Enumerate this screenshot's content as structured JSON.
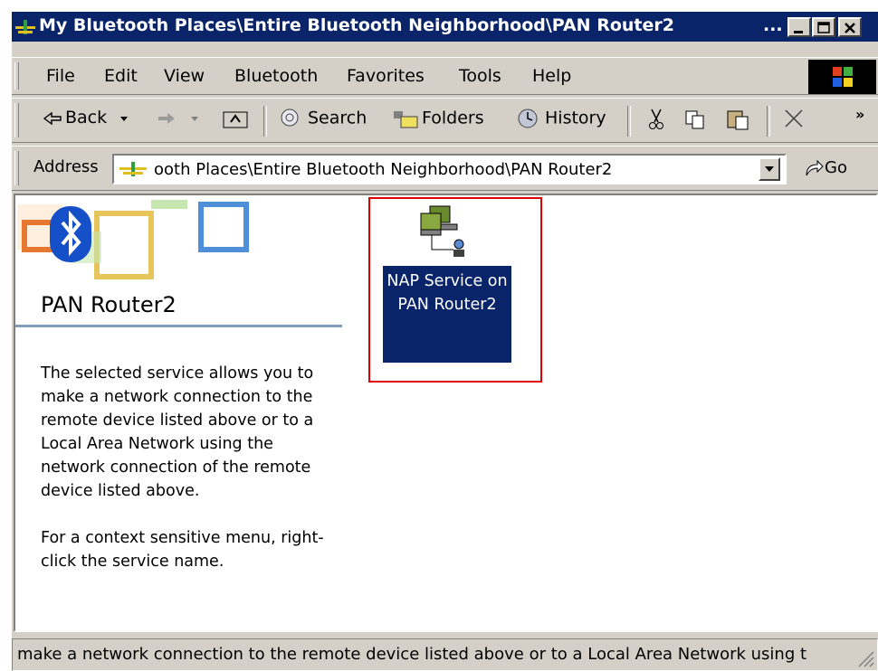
{
  "window": {
    "title": "My Bluetooth Places\\Entire Bluetooth Neighborhood\\PAN Router2",
    "title_ellipsis": "...",
    "title_color": "#0a246a"
  },
  "menu": {
    "items": [
      "File",
      "Edit",
      "View",
      "Bluetooth",
      "Favorites",
      "Tools",
      "Help"
    ]
  },
  "toolbar": {
    "back": "Back",
    "search": "Search",
    "folders": "Folders",
    "history": "History",
    "more": "»"
  },
  "address": {
    "label": "Address",
    "value": "ooth Places\\Entire Bluetooth Neighborhood\\PAN Router2",
    "go": "Go"
  },
  "left_pane": {
    "title": "PAN Router2",
    "description": "The selected service allows you to make a network connection to the remote device listed above or to a Local Area Network using the network connection of the remote device listed above.",
    "hint": "For a context sensitive menu, right-click the service name."
  },
  "service": {
    "label": "NAP Service on PAN Router2",
    "highlight_color": "#e00000"
  },
  "status": {
    "text": "make a network connection to the remote device listed above or to a Local Area Network using t"
  }
}
